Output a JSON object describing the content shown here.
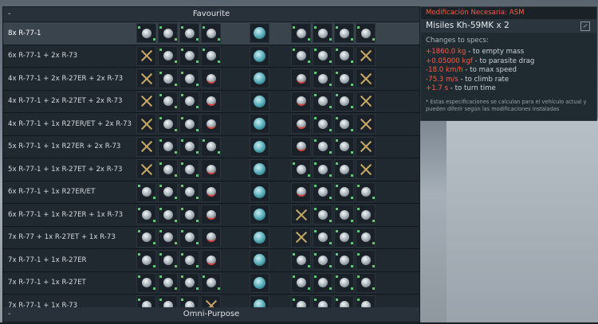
{
  "sections": {
    "favourite": "Favourite",
    "omni": "Omni-Purpose",
    "collapse": "-"
  },
  "presets": [
    {
      "name": "8x R-77-1"
    },
    {
      "name": "6x R-77-1  + 2x R-73"
    },
    {
      "name": "4x R-77-1 + 2x R-27ER + 2x R-73"
    },
    {
      "name": "4x R-77-1 + 2x R-27ET + 2x R-73"
    },
    {
      "name": "4x R-77-1 + 1x R27ER/ET + 2x R-73"
    },
    {
      "name": "5x R-77-1 + 1x R27ER + 2x R-73"
    },
    {
      "name": "5x R-77-1 + 1x R-27ET + 2x R-73"
    },
    {
      "name": "6x R-77-1 + 1x R27ER/ET"
    },
    {
      "name": "6x R-77-1 + 1x R-27ER + 1x R-73"
    },
    {
      "name": "7x R-77 + 1x R-27ET + 1x R-73"
    },
    {
      "name": "7x R-77-1 + 1x R-27ER"
    },
    {
      "name": "7x R-77-1 + 1x R-27ET"
    },
    {
      "name": "7x R-77-1 + 1x R-73"
    }
  ],
  "tooltip": {
    "header": "Modificación Necesaria: ASM",
    "title": "Misiles Kh-59MK x 2",
    "specs_label": "Changes to specs:",
    "specs": [
      {
        "value": "+1860.0 kg",
        "text": " - to empty mass"
      },
      {
        "value": "+0.05000 kgf",
        "text": " - to parasite drag"
      },
      {
        "value": "-18.0 km/h",
        "text": " - to max speed"
      },
      {
        "value": "-75.3 m/s",
        "text": " - to climb rate"
      },
      {
        "value": "+1.7 s",
        "text": " - to turn time"
      }
    ],
    "note": "* Estas especificaciones se calculan para el vehículo actual y pueden diferir según las modificaciones instaladas"
  },
  "colors": {
    "warning": "#ff5a46",
    "missile_green": "#5fcb73",
    "empty_x": "#c9a866",
    "pod_blue": "#4fa7b4"
  }
}
